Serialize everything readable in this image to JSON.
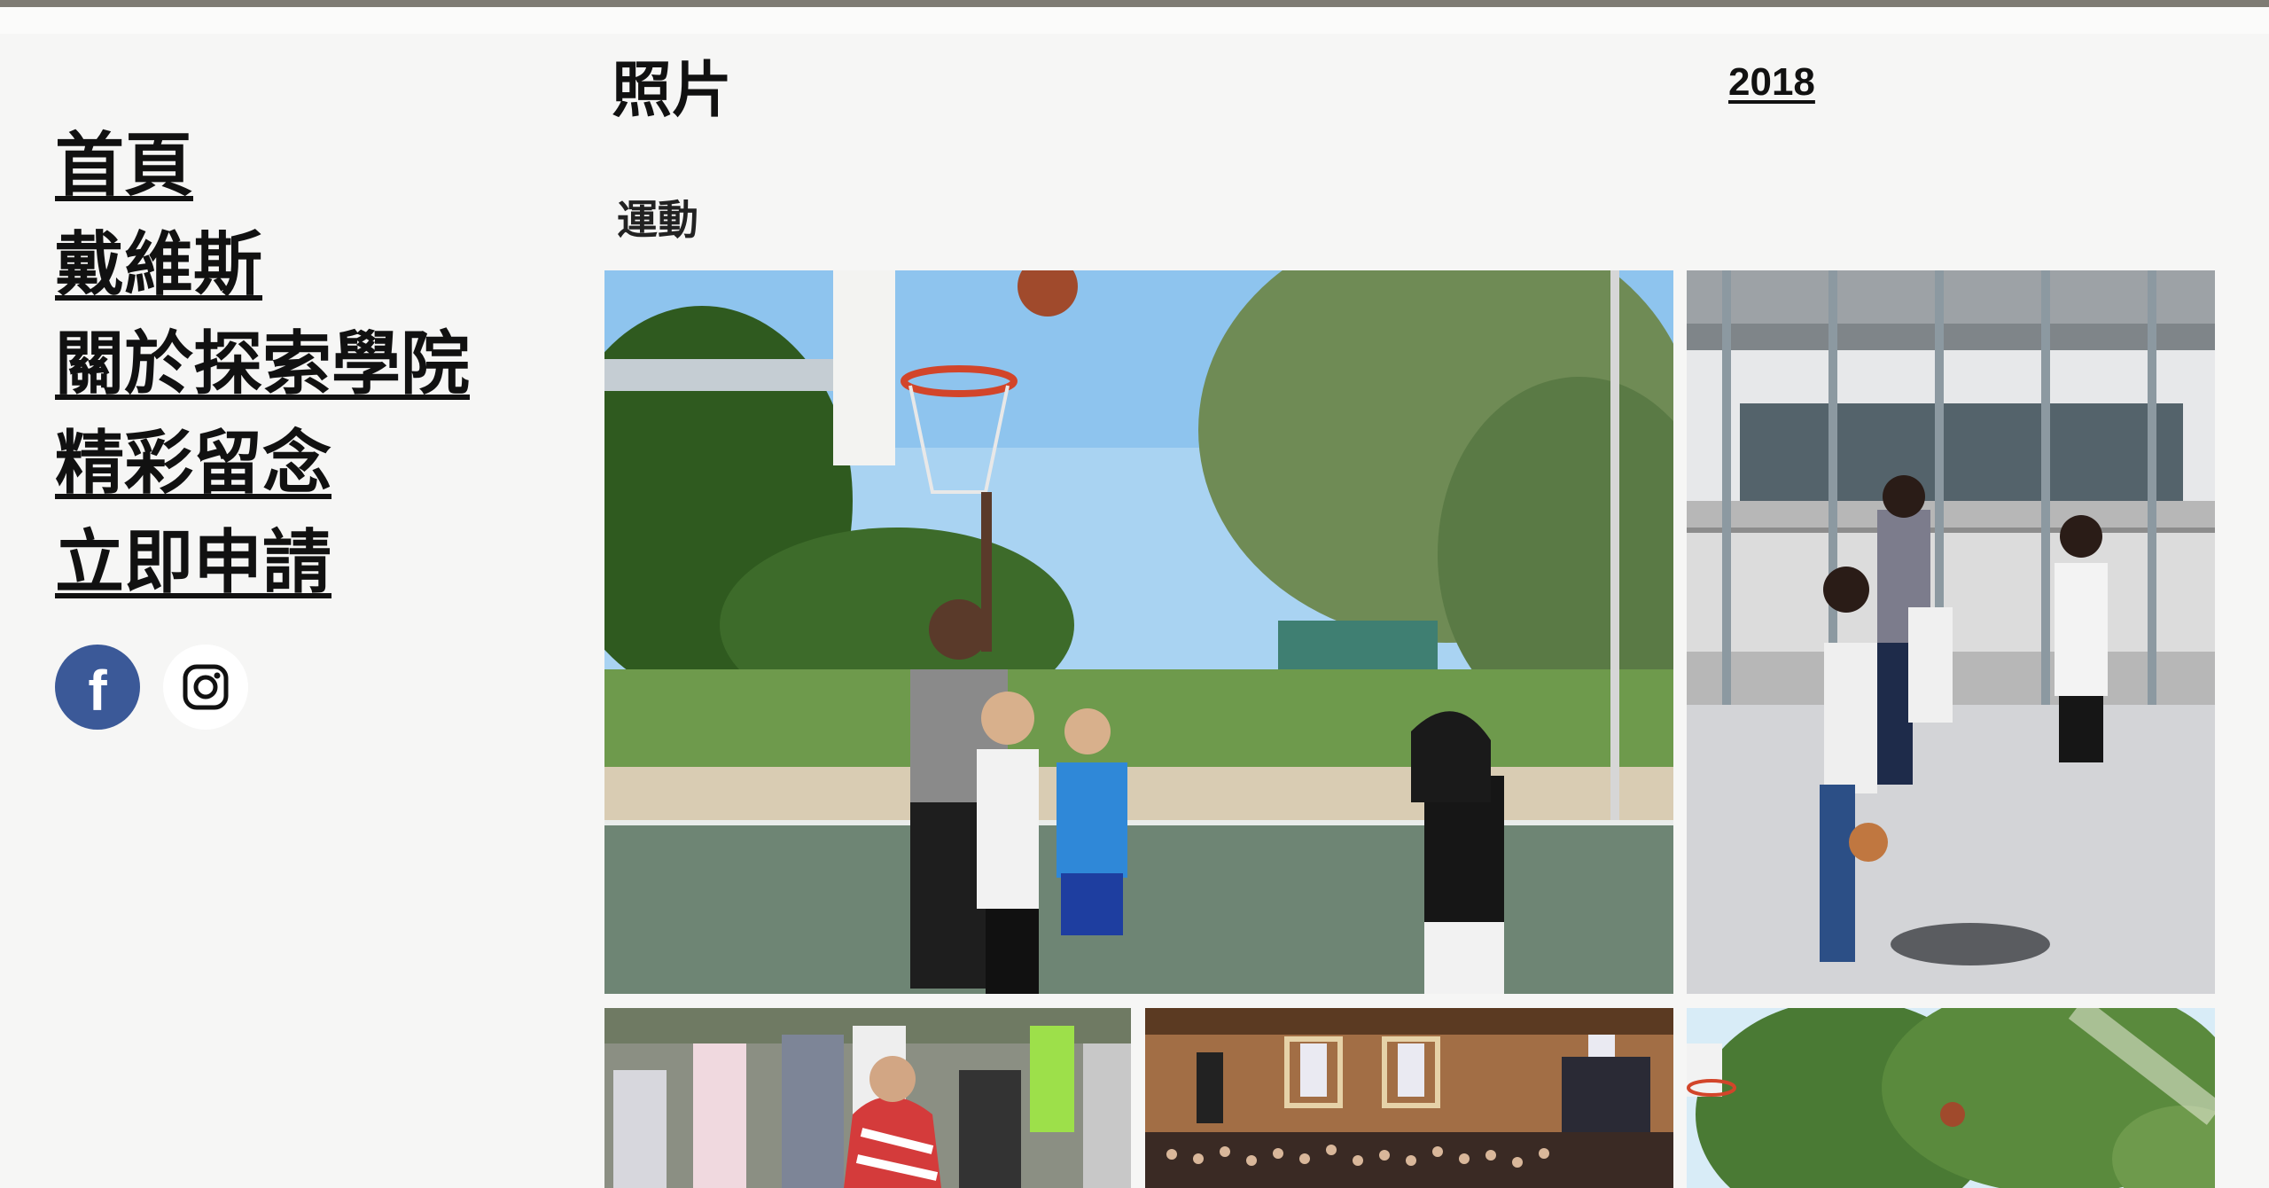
{
  "nav": {
    "items": [
      {
        "label": "首頁"
      },
      {
        "label": "戴維斯"
      },
      {
        "label": "關於探索學院"
      },
      {
        "label": "精彩留念"
      },
      {
        "label": "立即申請"
      }
    ]
  },
  "social": {
    "facebook_glyph": "f",
    "icons": [
      "facebook-icon",
      "instagram-icon"
    ],
    "facebook_color": "#3b5998"
  },
  "header": {
    "title": "照片",
    "year_link": "2018"
  },
  "gallery": {
    "section_label": "運動",
    "photos": [
      {
        "name": "photo-basketball-tipoff"
      },
      {
        "name": "photo-court-group"
      },
      {
        "name": "photo-crowd-outdoor"
      },
      {
        "name": "photo-gym-assembly"
      },
      {
        "name": "photo-trees-court"
      }
    ]
  },
  "colors": {
    "background": "#f6f6f5",
    "text": "#111111",
    "top_bar": "#7e7b73"
  }
}
